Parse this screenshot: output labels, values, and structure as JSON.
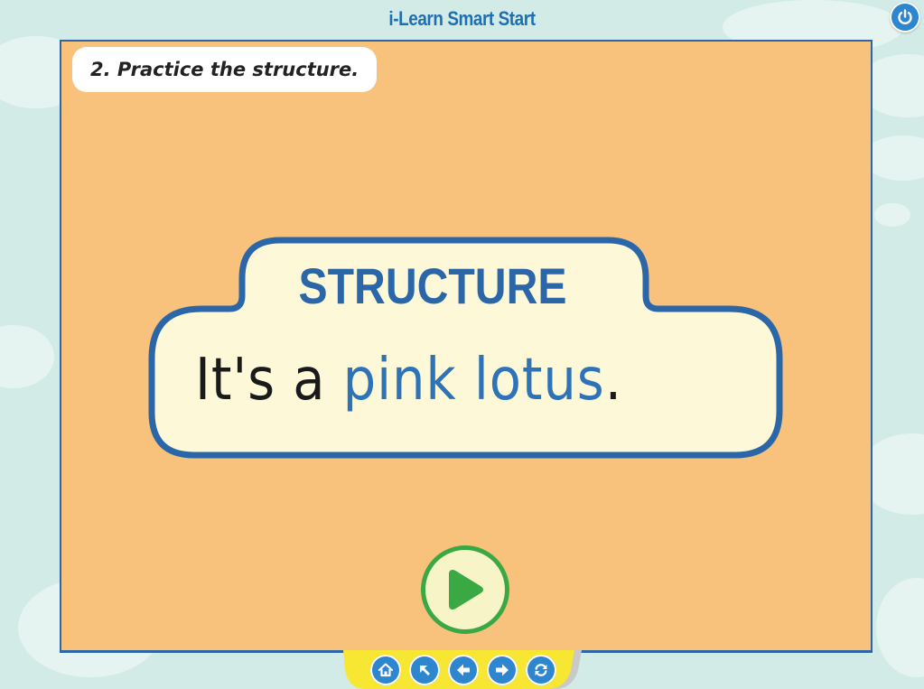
{
  "app": {
    "title": "i-Learn Smart Start"
  },
  "instruction": {
    "text": "2. Practice the structure."
  },
  "structure_card": {
    "heading": "STRUCTURE",
    "sentence_prefix": "It's a ",
    "sentence_highlight": "pink lotus",
    "sentence_suffix": "."
  },
  "controls": {
    "power": "power-icon",
    "play": "play-icon"
  },
  "nav_buttons": [
    "home-icon",
    "arrow-up-left-icon",
    "arrow-left-icon",
    "arrow-right-icon",
    "refresh-icon"
  ],
  "colors": {
    "background": "#d3ebe7",
    "stage": "#f9c27c",
    "stage_border": "#2b67a8",
    "card_fill": "#fdf9d8",
    "card_border": "#2b67a8",
    "accent_blue": "#2e72b8",
    "play_green": "#3aa843",
    "nav_yellow": "#f7e733"
  }
}
